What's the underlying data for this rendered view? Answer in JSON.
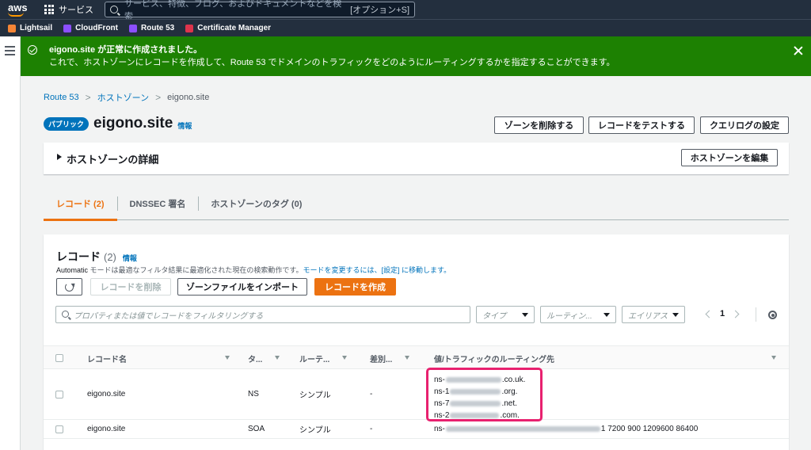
{
  "topnav": {
    "logo": "aws",
    "services_label": "サービス",
    "search_placeholder": "サービス、特徴、ブログ、およびドキュメントなどを検索",
    "search_shortcut": "[オプション+S]"
  },
  "favorites": [
    {
      "label": "Lightsail",
      "color": "#f58536",
      "icon": "lightsail-icon"
    },
    {
      "label": "CloudFront",
      "color": "#8c4fff",
      "icon": "cloudfront-icon"
    },
    {
      "label": "Route 53",
      "color": "#8c4fff",
      "icon": "route53-icon"
    },
    {
      "label": "Certificate Manager",
      "color": "#dd344c",
      "icon": "certificate-manager-icon"
    }
  ],
  "flash": {
    "title": "eigono.site が正常に作成されました。",
    "message": "これで、ホストゾーンにレコードを作成して、Route 53 でドメインのトラフィックをどのようにルーティングするかを指定することができます。",
    "color": "#1d8102"
  },
  "breadcrumb": {
    "items": [
      "Route 53",
      "ホストゾーン"
    ],
    "current": "eigono.site"
  },
  "zone": {
    "badge": "パブリック",
    "name": "eigono.site",
    "info": "情報"
  },
  "actions": {
    "delete_zone": "ゾーンを削除する",
    "test_record": "レコードをテストする",
    "query_log": "クエリログの設定"
  },
  "details": {
    "label": "ホストゾーンの詳細",
    "edit_button": "ホストゾーンを編集"
  },
  "tabs": [
    {
      "label": "レコード (2)",
      "active": true
    },
    {
      "label": "DNSSEC 署名",
      "active": false
    },
    {
      "label": "ホストゾーンのタグ (0)",
      "active": false
    }
  ],
  "records": {
    "title": "レコード",
    "count": "(2)",
    "info": "情報",
    "desc_mode": "Automatic",
    "desc_text": " モードは最適なフィルタ結果に最適化された現在の検索動作です。",
    "desc_link": "モードを変更するには、[設定] に移動します。",
    "delete_button": "レコードを削除",
    "import_button": "ゾーンファイルをインポート",
    "create_button": "レコードを作成",
    "filter_placeholder": "プロパティまたは値でレコードをフィルタリングする",
    "type_filter": "タイプ",
    "routing_filter": "ルーティン...",
    "alias_filter": "エイリアス",
    "page": "1",
    "columns": [
      "レコード名",
      "タ...",
      "ルーテ...",
      "差別...",
      "値/トラフィックのルーティング先"
    ],
    "rows": [
      {
        "name": "eigono.site",
        "type": "NS",
        "routing": "シンプル",
        "diff": "-",
        "values": [
          {
            "prefix": "ns-",
            "suffix": ".co.uk."
          },
          {
            "prefix": "ns-1",
            "suffix": ".org."
          },
          {
            "prefix": "ns-7",
            "suffix": ".net."
          },
          {
            "prefix": "ns-2",
            "suffix": ".com."
          }
        ]
      },
      {
        "name": "eigono.site",
        "type": "SOA",
        "routing": "シンプル",
        "diff": "-",
        "value_prefix": "ns-",
        "value_suffix": "1 7200 900 1209600 86400"
      }
    ]
  },
  "colors": {
    "accent": "#ec7211",
    "link": "#0073bb",
    "nav": "#232f3e",
    "highlight": "#e8216f"
  }
}
